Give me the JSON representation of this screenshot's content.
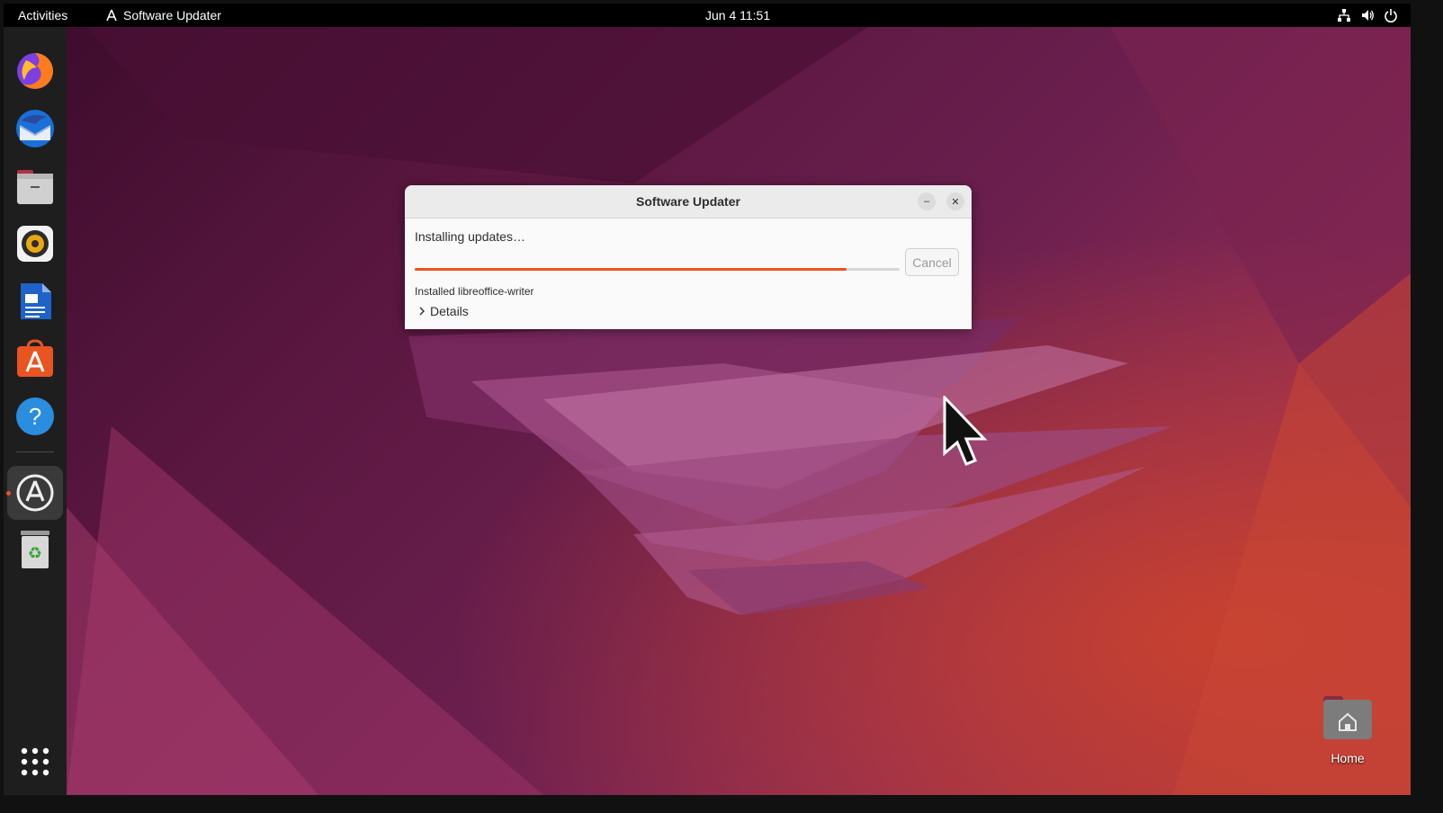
{
  "topbar": {
    "activities": "Activities",
    "app_name": "Software Updater",
    "clock": "Jun 4  11:51",
    "tray_icons": [
      "network-icon",
      "volume-icon",
      "power-icon"
    ]
  },
  "dock": {
    "items": [
      {
        "name": "firefox",
        "icon": "firefox-icon"
      },
      {
        "name": "thunderbird",
        "icon": "thunderbird-icon"
      },
      {
        "name": "files",
        "icon": "files-icon"
      },
      {
        "name": "rhythmbox",
        "icon": "rhythmbox-icon"
      },
      {
        "name": "libreoffice-writer",
        "icon": "writer-icon"
      },
      {
        "name": "ubuntu-software",
        "icon": "software-icon"
      },
      {
        "name": "help",
        "icon": "help-icon"
      },
      {
        "name": "software-updater",
        "icon": "updater-icon",
        "active": true
      },
      {
        "name": "trash",
        "icon": "trash-icon"
      }
    ],
    "show_apps_icon": "app-grid-icon"
  },
  "dialog": {
    "title": "Software Updater",
    "status": "Installing updates…",
    "progress": 0.89,
    "cancel_label": "Cancel",
    "detail": "Installed libreoffice-writer",
    "details_label": "Details"
  },
  "desktop": {
    "home_label": "Home"
  },
  "colors": {
    "accent": "#e95420",
    "topbar": "#000000",
    "dock": "#1e1e1e"
  }
}
